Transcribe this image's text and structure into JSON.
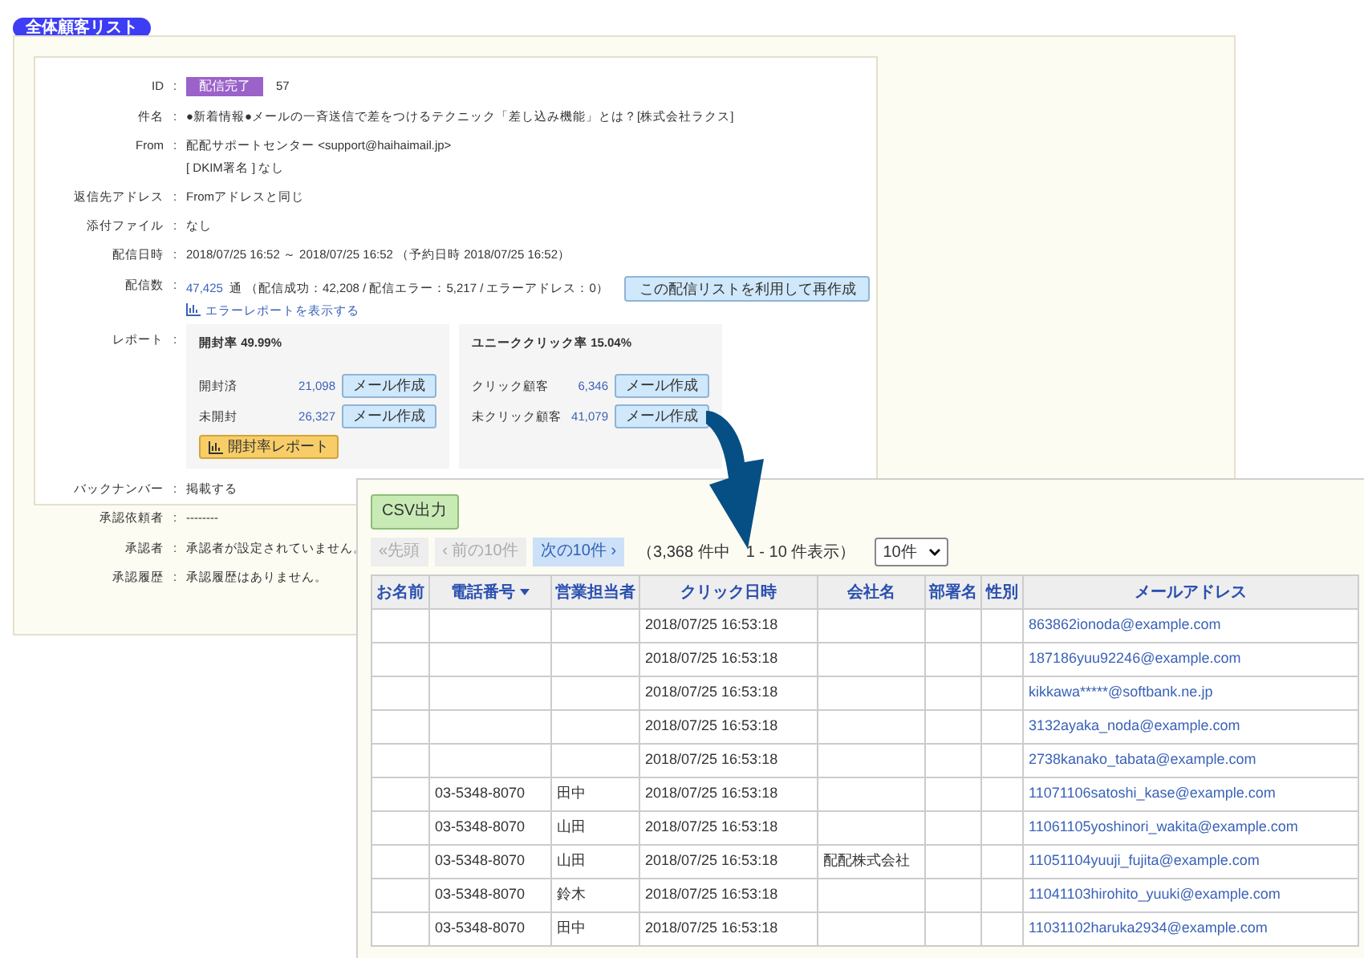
{
  "list_title": "全体顧客リスト",
  "details": [
    {
      "kind": "id",
      "colon": ":",
      "label": "ID",
      "badge": "配信完了",
      "value": "57"
    },
    {
      "kind": "text",
      "colon": ":",
      "label": "件名",
      "lines": [
        "●新着情報●メールの一斉送信で差をつけるテクニック「差し込み機能」とは？[株式会社ラクス]"
      ]
    },
    {
      "kind": "text",
      "colon": ":",
      "label": "From",
      "lines": [
        "配配サポートセンター <support@haihaimail.jp>",
        "[ DKIM署名 ] なし"
      ]
    },
    {
      "kind": "text",
      "colon": ":",
      "label": "返信先アドレス",
      "lines": [
        "Fromアドレスと同じ"
      ]
    },
    {
      "kind": "text",
      "colon": ":",
      "label": "添付ファイル",
      "lines": [
        "なし"
      ]
    },
    {
      "kind": "text",
      "colon": ":",
      "label": "配信日時",
      "lines": [
        "2018/07/25 16:52 ～ 2018/07/25 16:52 （予約日時 2018/07/25 16:52）"
      ]
    },
    {
      "kind": "count",
      "colon": ":",
      "label": "配信数",
      "count": "47,425",
      "text": "通 （配信成功：42,208 / 配信エラー：5,217 / エラーアドレス：0）",
      "button": "この配信リストを利用して再作成",
      "link": "エラーレポートを表示する"
    },
    {
      "kind": "report",
      "colon": ":",
      "label": "レポート",
      "cards": [
        {
          "title": "開封率 49.99%",
          "rows": [
            {
              "label": "開封済",
              "count": "21,098",
              "button": "メール作成"
            },
            {
              "label": "未開封",
              "count": "26,327",
              "button": "メール作成"
            }
          ],
          "report_button": "開封率レポート"
        },
        {
          "title": "ユニーククリック率 15.04%",
          "rows": [
            {
              "label": "クリック顧客",
              "count": "6,346",
              "button": "メール作成"
            },
            {
              "label": "未クリック顧客",
              "count": "41,079",
              "button": "メール作成"
            }
          ]
        }
      ]
    },
    {
      "kind": "text",
      "colon": ":",
      "label": "バックナンバー",
      "lines": [
        "掲載する"
      ]
    },
    {
      "kind": "text",
      "colon": ":",
      "label": "承認依頼者",
      "lines": [
        "--------"
      ]
    },
    {
      "kind": "text",
      "colon": ":",
      "label": "承認者",
      "lines": [
        "承認者が設定されていません。"
      ]
    },
    {
      "kind": "text",
      "colon": ":",
      "label": "承認履歴",
      "lines": [
        "承認履歴はありません。"
      ]
    }
  ],
  "export_button": "CSV出力",
  "pager": [
    {
      "label": "«先頭",
      "disabled": true
    },
    {
      "label": "‹ 前の10件",
      "disabled": true
    },
    {
      "label": "次の10件 ›",
      "disabled": false
    }
  ],
  "pager_summary": "（3,368 件中　1 - 10 件表示）",
  "page_size": "10件",
  "table": {
    "columns": [
      {
        "label": "お名前",
        "sorted": false
      },
      {
        "label": "電話番号",
        "sorted": true
      },
      {
        "label": "営業担当者",
        "sorted": false
      },
      {
        "label": "クリック日時",
        "sorted": false
      },
      {
        "label": "会社名",
        "sorted": false
      },
      {
        "label": "部署名",
        "sorted": false
      },
      {
        "label": "性別",
        "sorted": false
      },
      {
        "label": "メールアドレス",
        "sorted": false
      }
    ],
    "rows": [
      [
        "",
        "",
        "",
        "2018/07/25 16:53:18",
        "",
        "",
        "",
        "863862ionoda@example.com"
      ],
      [
        "",
        "",
        "",
        "2018/07/25 16:53:18",
        "",
        "",
        "",
        "187186yuu92246@example.com"
      ],
      [
        "",
        "",
        "",
        "2018/07/25 16:53:18",
        "",
        "",
        "",
        "kikkawa*****@softbank.ne.jp"
      ],
      [
        "",
        "",
        "",
        "2018/07/25 16:53:18",
        "",
        "",
        "",
        "3132ayaka_noda@example.com"
      ],
      [
        "",
        "",
        "",
        "2018/07/25 16:53:18",
        "",
        "",
        "",
        "2738kanako_tabata@example.com"
      ],
      [
        "",
        "03-5348-8070",
        "田中",
        "2018/07/25 16:53:18",
        "",
        "",
        "",
        "11071106satoshi_kase@example.com"
      ],
      [
        "",
        "03-5348-8070",
        "山田",
        "2018/07/25 16:53:18",
        "",
        "",
        "",
        "11061105yoshinori_wakita@example.com"
      ],
      [
        "",
        "03-5348-8070",
        "山田",
        "2018/07/25 16:53:18",
        "配配株式会社",
        "",
        "",
        "11051104yuuji_fujita@example.com"
      ],
      [
        "",
        "03-5348-8070",
        "鈴木",
        "2018/07/25 16:53:18",
        "",
        "",
        "",
        "11041103hirohito_yuuki@example.com"
      ],
      [
        "",
        "03-5348-8070",
        "田中",
        "2018/07/25 16:53:18",
        "",
        "",
        "",
        "11031102haruka2934@example.com"
      ]
    ]
  }
}
